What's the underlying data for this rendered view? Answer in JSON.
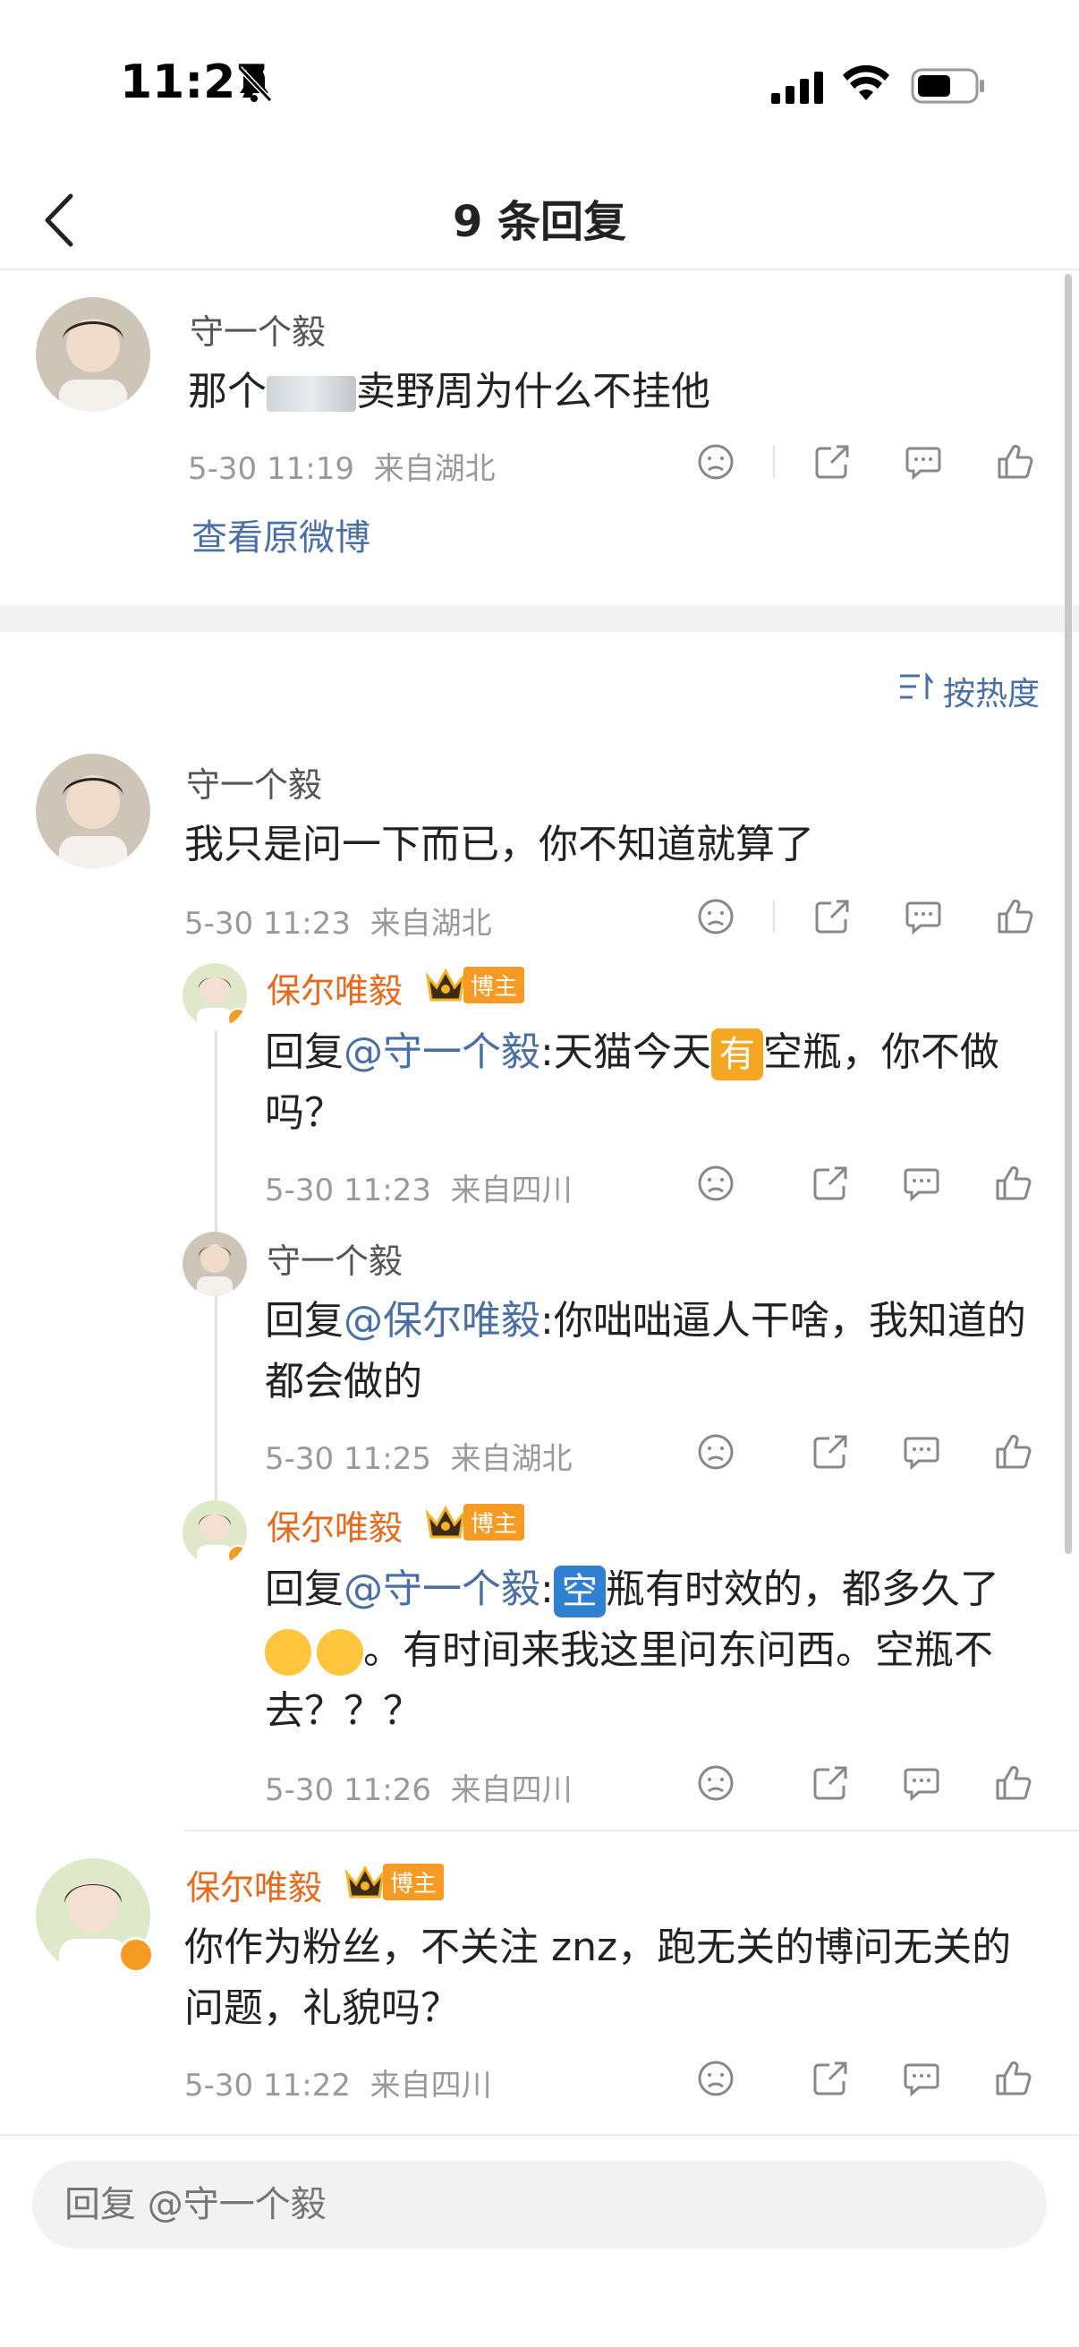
{
  "status": {
    "time": "11:27"
  },
  "nav": {
    "title": "9 条回复"
  },
  "original_comment": {
    "username": "守一个毅",
    "text_a": "那个",
    "text_b": "卖野周为什么不挂他",
    "time": "5-30 11:19",
    "location": "来自湖北",
    "view_original": "查看原微博"
  },
  "sort": {
    "label": "按热度"
  },
  "comments": [
    {
      "username": "守一个毅",
      "text": "我只是问一下而已，你不知道就算了",
      "time": "5-30 11:23",
      "location": "来自湖北"
    },
    {
      "username": "保尔唯毅",
      "badge": "博主",
      "reply_prefix": "回复",
      "mention": "@守一个毅",
      "text_a": ":天猫今天",
      "emoji": "有",
      "text_b": "空瓶，你不做吗？",
      "time": "5-30 11:23",
      "location": "来自四川"
    },
    {
      "username": "守一个毅",
      "reply_prefix": "回复",
      "mention": "@保尔唯毅",
      "text": ":你咄咄逼人干啥，我知道的都会做的",
      "time": "5-30 11:25",
      "location": "来自湖北"
    },
    {
      "username": "保尔唯毅",
      "badge": "博主",
      "reply_prefix": "回复",
      "mention": "@守一个毅",
      "emoji": "空",
      "text_a": ":",
      "text_b": "瓶有时效的，都多久了",
      "text_c": "。有时间来我这里问东问西。空瓶不去？？？",
      "time": "5-30 11:26",
      "location": "来自四川"
    },
    {
      "username": "保尔唯毅",
      "badge": "博主",
      "text": "你作为粉丝，不关注 znz，跑无关的博问无关的问题，礼貌吗？",
      "time": "5-30 11:22",
      "location": "来自四川"
    }
  ],
  "reply_input": {
    "placeholder": "回复 @守一个毅"
  },
  "colors": {
    "accent_blue": "#4a6fa5",
    "blogger_orange": "#e8691b",
    "badge_orange": "#f59a23"
  }
}
